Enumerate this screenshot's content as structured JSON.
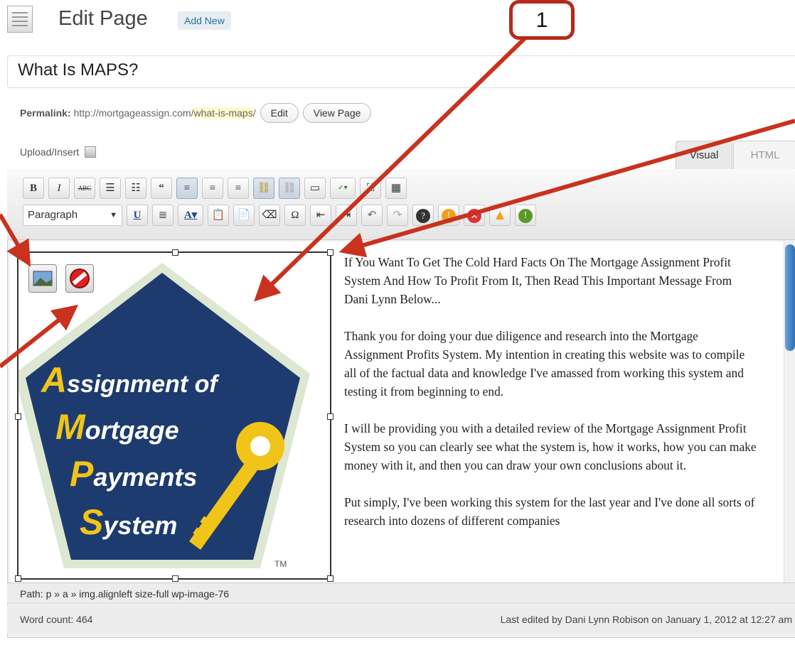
{
  "header": {
    "title": "Edit Page",
    "add_new": "Add New"
  },
  "post": {
    "title": "What Is MAPS?"
  },
  "permalink": {
    "label": "Permalink:",
    "base": "http://mortgageassign.com/",
    "slug": "what-is-maps",
    "trailing": "/",
    "edit_label": "Edit",
    "view_label": "View Page"
  },
  "upload_insert": "Upload/Insert",
  "tabs": {
    "visual": "Visual",
    "html": "HTML"
  },
  "toolbar": {
    "format_select": "Paragraph"
  },
  "logo": {
    "line1": "ssignment of",
    "line1_cap": "A",
    "line2": "ortgage",
    "line2_cap": "M",
    "line3": "ayments",
    "line3_cap": "P",
    "line4": "ystem",
    "line4_cap": "S",
    "tm": "TM"
  },
  "body": {
    "p1": "If You Want To Get The Cold Hard Facts On The Mortgage Assignment Profit System And How To Profit From It, Then Read This Important Message From Dani Lynn Below...",
    "p2": "Thank you for doing your due diligence and research into the Mortgage Assignment Profits System. My intention in creating this website was to compile all of the factual data and knowledge I've amassed from working this system and testing it from beginning to end.",
    "p3": "I will be providing you with a detailed review of the Mortgage Assignment Profit System so you can clearly see what the system is, how it works, how you can make money with it, and then you can draw your own conclusions about it.",
    "p4": "Put simply, I've been working this system for the last year and I've done all sorts of research into dozens of different companies"
  },
  "path_bar": {
    "label": "Path:",
    "value": "p » a » img.alignleft size-full wp-image-76"
  },
  "status": {
    "word_count": "Word count: 464",
    "last_edited": "Last edited by Dani Lynn Robison on January 1, 2012 at 12:27 am"
  },
  "annotation": {
    "badge": "1"
  },
  "colors": {
    "annotation_red": "#c8321f",
    "logo_navy": "#1d3b6e",
    "logo_gold": "#f0c419"
  }
}
